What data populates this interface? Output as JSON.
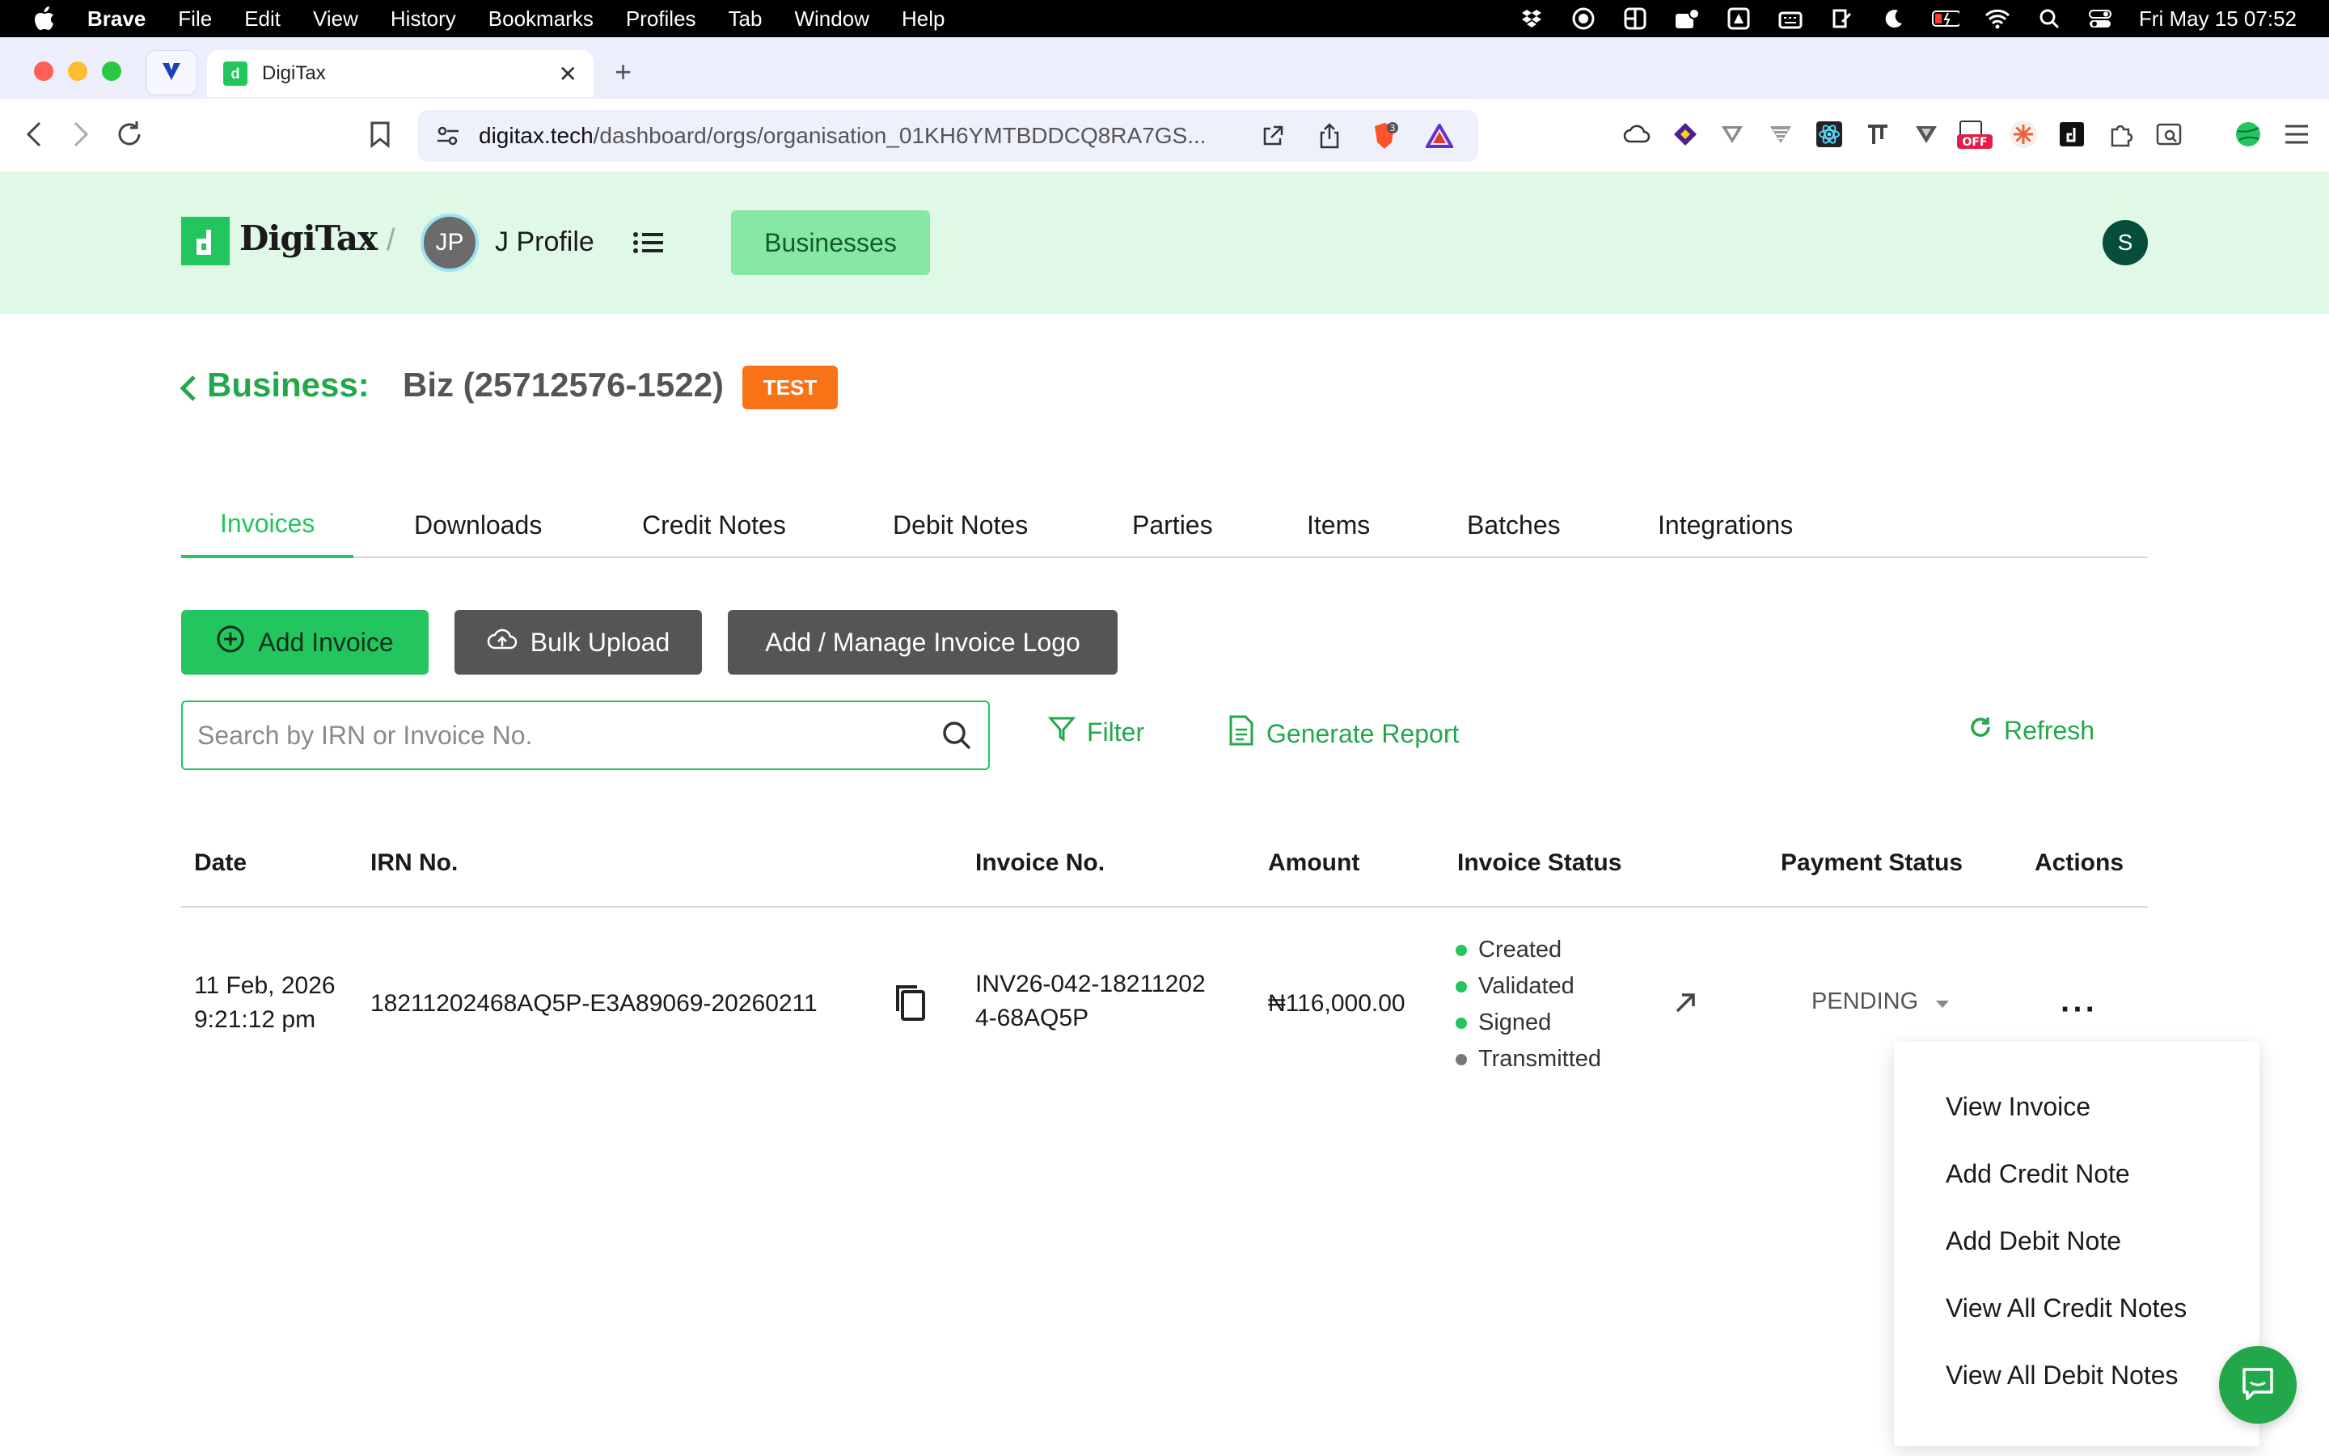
{
  "menubar": {
    "app": "Brave",
    "items": [
      "File",
      "Edit",
      "View",
      "History",
      "Bookmarks",
      "Profiles",
      "Tab",
      "Window",
      "Help"
    ],
    "clock": "Fri May 15  07:52"
  },
  "browser": {
    "tab_title": "DigiTax",
    "url_host": "digitax.tech",
    "url_rest": "/dashboard/orgs/organisation_01KH6YMTBDDCQ8RA7GS...",
    "shield_count": "3"
  },
  "header": {
    "logo": "DigiTax",
    "profile_initials": "JP",
    "profile_name": "J Profile",
    "businesses_button": "Businesses",
    "user_initial": "S"
  },
  "business": {
    "label": "Business:",
    "name": "Biz (25712576-1522)",
    "badge": "TEST"
  },
  "tabs": [
    "Invoices",
    "Downloads",
    "Credit Notes",
    "Debit Notes",
    "Parties",
    "Items",
    "Batches",
    "Integrations"
  ],
  "toolbar": {
    "add_invoice": "Add Invoice",
    "bulk_upload": "Bulk Upload",
    "manage_logo": "Add / Manage Invoice Logo",
    "search_placeholder": "Search by IRN or Invoice No.",
    "filter": "Filter",
    "generate_report": "Generate Report",
    "refresh": "Refresh"
  },
  "table": {
    "headers": [
      "Date",
      "IRN No.",
      "Invoice No.",
      "Amount",
      "Invoice Status",
      "Payment Status",
      "Actions"
    ],
    "rows": [
      {
        "date_line1": "11 Feb, 2026",
        "date_line2": "9:21:12 pm",
        "irn": "18211202468AQ5P-E3A89069-20260211",
        "invoice_line1": "INV26-042-18211202",
        "invoice_line2": "4-68AQ5P",
        "amount": "₦116,000.00",
        "statuses": [
          "Created",
          "Validated",
          "Signed",
          "Transmitted"
        ],
        "payment_status": "PENDING"
      }
    ]
  },
  "actions_menu": [
    "View Invoice",
    "Add Credit Note",
    "Add Debit Note",
    "View All Credit Notes",
    "View All Debit Notes"
  ],
  "colors": {
    "brand_green": "#22c55e",
    "header_bg": "#e0f8e6",
    "test_badge": "#f97316",
    "dark_button": "#555555"
  }
}
